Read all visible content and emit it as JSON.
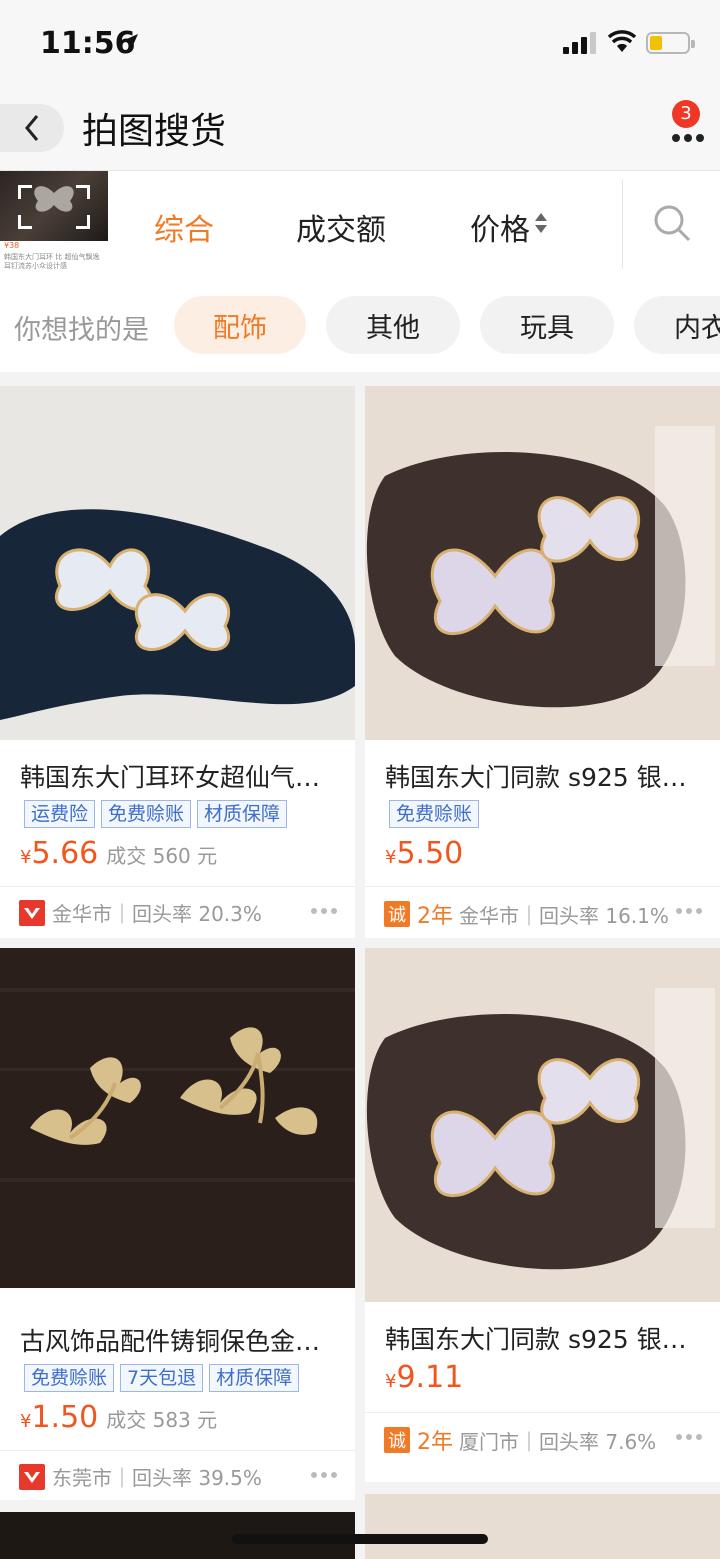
{
  "status": {
    "time": "11:56"
  },
  "nav": {
    "title": "拍图搜货",
    "badge": "3"
  },
  "sort": {
    "items": [
      "综合",
      "成交额",
      "价格"
    ],
    "active": "综合"
  },
  "thumb": {
    "t1": "¥38",
    "t2": "韩国东大门耳环 比 超仙气飘逸耳钉流苏小众设计感"
  },
  "filters": {
    "label": "你想找的是",
    "chips": [
      "配饰",
      "其他",
      "玩具",
      "内衣"
    ]
  },
  "products": [
    {
      "name": "韩国东大门耳环女超仙气…",
      "tags": [
        "运费险",
        "免费赊账",
        "材质保障"
      ],
      "price": "5.66",
      "deal": "成交 560 元",
      "shop_year": "",
      "shop": "金华市｜回头率 20.3%"
    },
    {
      "name": "韩国东大门同款 s925 银…",
      "tags": [
        "免费赊账"
      ],
      "price": "5.50",
      "deal": "",
      "shop_year": "2年",
      "shop": "金华市｜回头率 16.1%"
    },
    {
      "name": "古风饰品配件铸铜保色金…",
      "tags": [
        "免费赊账",
        "7天包退",
        "材质保障"
      ],
      "price": "1.50",
      "deal": "成交 583 元",
      "shop_year": "",
      "shop": "东莞市｜回头率 39.5%"
    },
    {
      "name": "韩国东大门同款 s925 银…",
      "tags": [],
      "price": "9.11",
      "deal": "",
      "shop_year": "2年",
      "shop": "厦门市｜回头率 7.6%"
    }
  ],
  "currency": "¥",
  "colors": {
    "accent": "#f07a25",
    "price": "#f0561d",
    "tag": "#3f6fca"
  }
}
